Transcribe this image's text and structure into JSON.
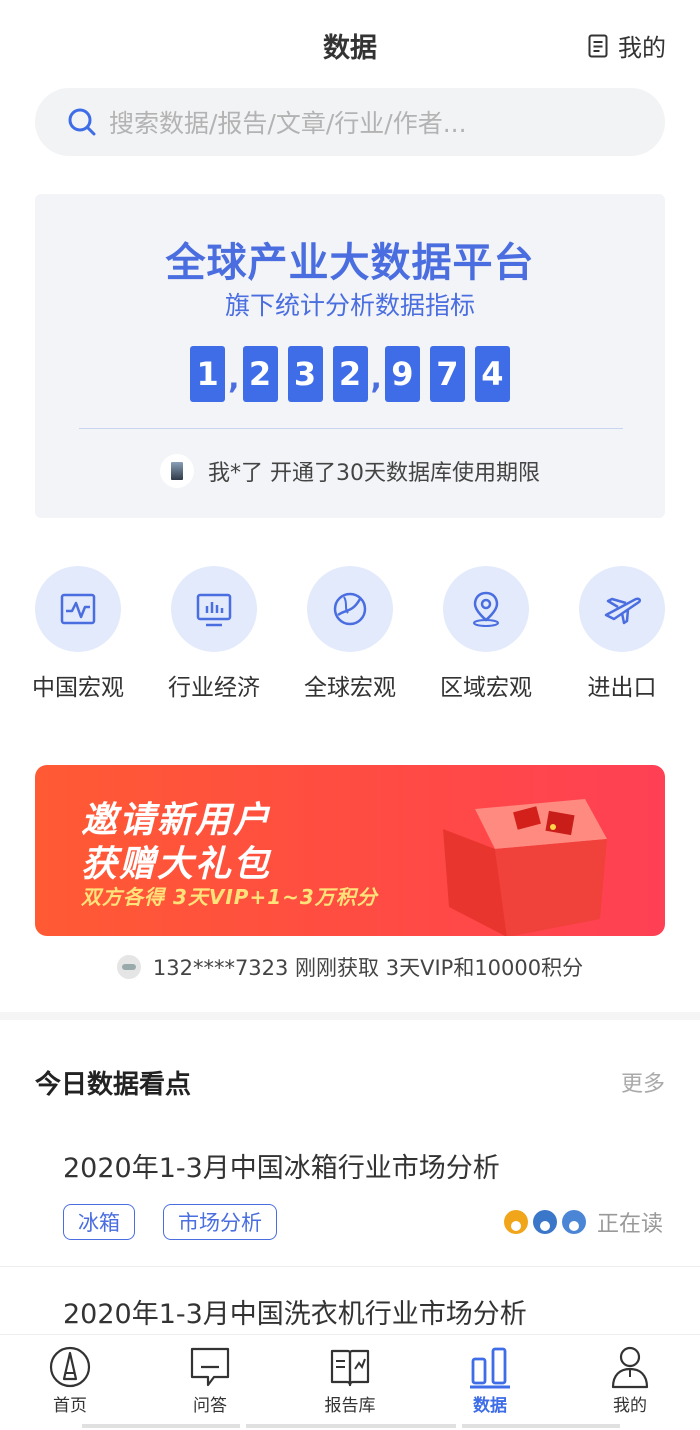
{
  "header": {
    "title": "数据",
    "mine_label": "我的"
  },
  "search": {
    "placeholder": "搜索数据/报告/文章/行业/作者..."
  },
  "platform": {
    "title": "全球产业大数据平台",
    "subtitle": "旗下统计分析数据指标",
    "count_digits": [
      "1",
      ",",
      "2",
      "3",
      "2",
      ",",
      "9",
      "7",
      "4"
    ],
    "notice": "我*了 开通了30天数据库使用期限"
  },
  "categories": [
    {
      "label": "中国宏观",
      "icon": "chart-wave-icon"
    },
    {
      "label": "行业经济",
      "icon": "monitor-bars-icon"
    },
    {
      "label": "全球宏观",
      "icon": "globe-icon"
    },
    {
      "label": "区域宏观",
      "icon": "location-pin-icon"
    },
    {
      "label": "进出口",
      "icon": "airplane-icon"
    }
  ],
  "banner": {
    "line1": "邀请新用户",
    "line2": "获赠大礼包",
    "line3": "双方各得 3天VIP+1~3万积分"
  },
  "claim_notice": "132****7323 刚刚获取 3天VIP和10000积分",
  "today": {
    "title": "今日数据看点",
    "more": "更多",
    "articles": [
      {
        "title": "2020年1-3月中国冰箱行业市场分析",
        "tags": [
          "冰箱",
          "市场分析"
        ],
        "reading_label": "正在读"
      },
      {
        "title": "2020年1-3月中国洗衣机行业市场分析"
      }
    ]
  },
  "tabbar": {
    "items": [
      {
        "label": "首页",
        "icon": "home-icon"
      },
      {
        "label": "问答",
        "icon": "qa-icon"
      },
      {
        "label": "报告库",
        "icon": "report-book-icon"
      },
      {
        "label": "数据",
        "icon": "data-bars-icon",
        "active": true
      },
      {
        "label": "我的",
        "icon": "person-icon"
      }
    ]
  },
  "colors": {
    "accent": "#3f6de8",
    "banner": "#ff4a45",
    "icon_bg": "#e3eafc"
  }
}
